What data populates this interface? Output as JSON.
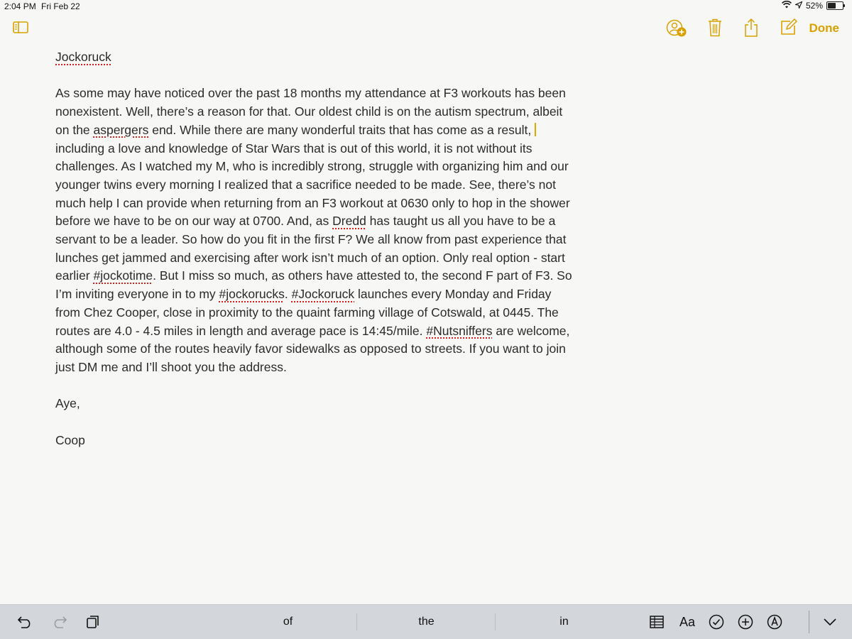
{
  "status_bar": {
    "time": "2:04 PM",
    "date": "Fri Feb 22",
    "battery_text": "52%",
    "battery_level": 0.52
  },
  "toolbar": {
    "done_label": "Done",
    "accent_color": "#d9a100"
  },
  "note": {
    "title": "Jockoruck",
    "body": [
      "As some may have noticed over the past 18 months my attendance at F3 workouts has been nonexistent.  Well, there’s a reason for that.  Our oldest child is on the autism spectrum, albeit on the ",
      "aspergers",
      " end.  While there are many wonderful traits that has come as a result, ",
      "including a love and knowledge of Star Wars that is out of this world, it is not without its challenges.  As I watched my M, who is incredibly strong, struggle with organizing him and our younger twins every morning I realized that a sacrifice needed to be made.  See, there’s not much help I can provide when returning from an F3 workout at 0630 only to hop in the shower before we have to be on our way at 0700.  And, as ",
      "Dredd",
      " has taught us all you have to be a servant to be a leader.  So how do you fit in the first F? We all know from past experience that lunches get jammed and exercising after work isn’t much of an option.  Only real option - start earlier ",
      "#jockotime",
      ".  But I miss so much, as others have attested to, the second F part of F3.  So I’m inviting everyone in to my ",
      "#jockorucks",
      ".  ",
      "#Jockoruck",
      " launches every Monday and Friday from Chez Cooper, close in proximity to the quaint farming village of Cotswald, at 0445.  The routes are 4.0 - 4.5 miles in length and average pace is 14:45/mile.  ",
      "#Nutsniffers",
      " are welcome, although some of the routes heavily favor sidewalks as opposed to streets.  If you want to join just DM me and I’ll shoot you the address."
    ],
    "closing": "Aye,",
    "signature": "Coop"
  },
  "keyboard_bar": {
    "suggestions": [
      "of",
      "the",
      "in"
    ],
    "format_label": "Aa"
  }
}
